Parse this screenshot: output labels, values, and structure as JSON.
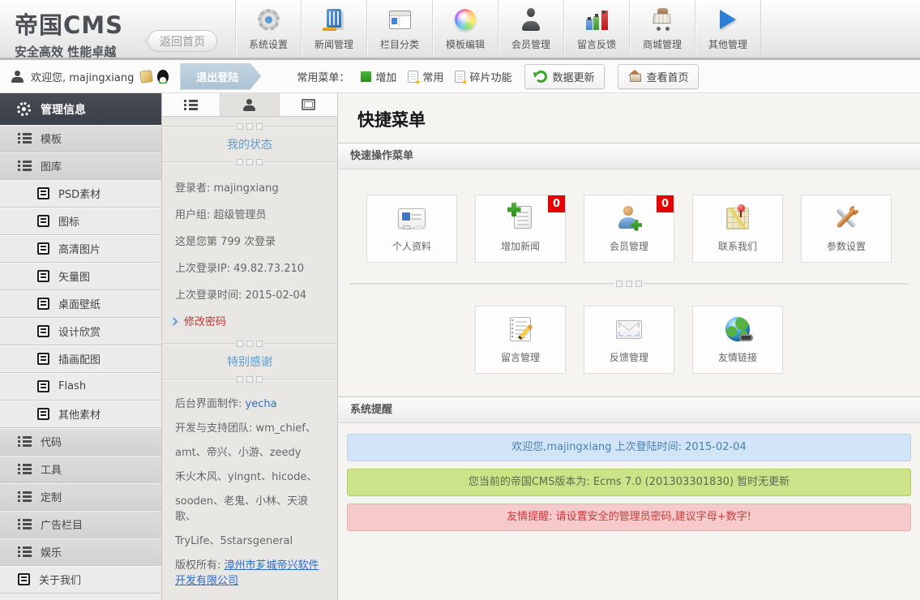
{
  "header": {
    "logo_title": "帝国CMS",
    "logo_subtitle": "安全高效 性能卓越",
    "back_home": "返回首页",
    "nav": [
      {
        "label": "系统设置",
        "icon": "gear-icon"
      },
      {
        "label": "新闻管理",
        "icon": "news-icon"
      },
      {
        "label": "栏目分类",
        "icon": "columns-icon"
      },
      {
        "label": "模板编辑",
        "icon": "palette-icon"
      },
      {
        "label": "会员管理",
        "icon": "person-icon"
      },
      {
        "label": "留言反馈",
        "icon": "chart-icon"
      },
      {
        "label": "商城管理",
        "icon": "cart-icon"
      },
      {
        "label": "其他管理",
        "icon": "play-icon"
      }
    ]
  },
  "toolbar": {
    "welcome": "欢迎您, majingxiang",
    "logout": "退出登陆",
    "menu_label": "常用菜单：",
    "links": [
      {
        "label": "增加",
        "icon": "plus-icon"
      },
      {
        "label": "常用",
        "icon": "doc-star-icon"
      },
      {
        "label": "碎片功能",
        "icon": "doc-star-icon"
      }
    ],
    "buttons": [
      {
        "label": "数据更新",
        "icon": "refresh-icon"
      },
      {
        "label": "查看首页",
        "icon": "home-icon"
      }
    ]
  },
  "sidebar": {
    "title": "管理信息",
    "items": [
      {
        "label": "模板",
        "icon": "list-icon",
        "level": "top"
      },
      {
        "label": "图库",
        "icon": "list-icon",
        "level": "top"
      },
      {
        "label": "PSD素材",
        "icon": "doc-icon",
        "level": "sub"
      },
      {
        "label": "图标",
        "icon": "doc-icon",
        "level": "sub"
      },
      {
        "label": "高清图片",
        "icon": "doc-icon",
        "level": "sub"
      },
      {
        "label": "矢量图",
        "icon": "doc-icon",
        "level": "sub"
      },
      {
        "label": "桌面壁纸",
        "icon": "doc-icon",
        "level": "sub"
      },
      {
        "label": "设计欣赏",
        "icon": "doc-icon",
        "level": "sub"
      },
      {
        "label": "插画配图",
        "icon": "doc-icon",
        "level": "sub"
      },
      {
        "label": "Flash",
        "icon": "doc-icon",
        "level": "sub"
      },
      {
        "label": "其他素材",
        "icon": "doc-icon",
        "level": "sub"
      },
      {
        "label": "代码",
        "icon": "list-icon",
        "level": "top"
      },
      {
        "label": "工具",
        "icon": "list-icon",
        "level": "top"
      },
      {
        "label": "定制",
        "icon": "list-icon",
        "level": "top"
      },
      {
        "label": "广告栏目",
        "icon": "list-icon",
        "level": "top"
      },
      {
        "label": "娱乐",
        "icon": "list-icon",
        "level": "top"
      },
      {
        "label": "关于我们",
        "icon": "doc-icon",
        "level": "toplight"
      }
    ]
  },
  "panel": {
    "tabs": [
      {
        "icon": "list-icon",
        "active": false
      },
      {
        "icon": "user-icon",
        "active": true
      },
      {
        "icon": "expand-icon",
        "active": false
      }
    ],
    "status": {
      "title": "我的状态",
      "lines": [
        "登录者: majingxiang",
        "用户组: 超级管理员",
        "这是您第 799 次登录",
        "上次登录IP: 49.82.73.210",
        "上次登录时间: 2015-02-04"
      ],
      "change_password": "修改密码"
    },
    "thanks": {
      "title": "特别感谢",
      "maker_label": "后台界面制作: ",
      "maker_link": "yecha",
      "team_lines": [
        "开发与支持团队: wm_chief、",
        "amt、帝兴、小游、zeedy",
        "禾火木风、yingnt、hicode、",
        "sooden、老鬼、小林、天浪歌、",
        "TryLife、5starsgeneral"
      ],
      "copyright_label": "版权所有: ",
      "copyright_link": "漳州市芗城帝兴软件开发有限公司"
    }
  },
  "main": {
    "title": "快捷菜单",
    "quick_section": "快速操作菜单",
    "quick_buttons_row1": [
      {
        "label": "个人资料",
        "icon": "idcard-icon"
      },
      {
        "label": "增加新闻",
        "icon": "add-news-icon",
        "badge": "0"
      },
      {
        "label": "会员管理",
        "icon": "member-icon",
        "badge": "0"
      },
      {
        "label": "联系我们",
        "icon": "map-icon"
      },
      {
        "label": "参数设置",
        "icon": "tools-icon"
      }
    ],
    "quick_buttons_row2": [
      {
        "label": "留言管理",
        "icon": "notepad-icon"
      },
      {
        "label": "反馈管理",
        "icon": "mail-icon"
      },
      {
        "label": "友情链接",
        "icon": "globe-icon"
      }
    ],
    "alerts_section": "系统提醒",
    "alerts": [
      {
        "kind": "info",
        "text": "欢迎您,majingxiang 上次登陆时间: 2015-02-04"
      },
      {
        "kind": "success",
        "text": "您当前的帝国CMS版本为: Ecms 7.0 (201303301830) 暂时无更新"
      },
      {
        "kind": "error",
        "text": "友情提醒: 请设置安全的管理员密码,建议字母+数字!"
      }
    ]
  },
  "colors": {
    "badge_red": "#e70000",
    "link_blue": "#2d6cc9",
    "heading_blue": "#5b9fd6",
    "password_red": "#c23434",
    "alert_info_bg": "#d1e5f7",
    "alert_success_bg": "#cde38a",
    "alert_error_bg": "#f6caca",
    "sidebar_header_bg": "#3f444b"
  }
}
